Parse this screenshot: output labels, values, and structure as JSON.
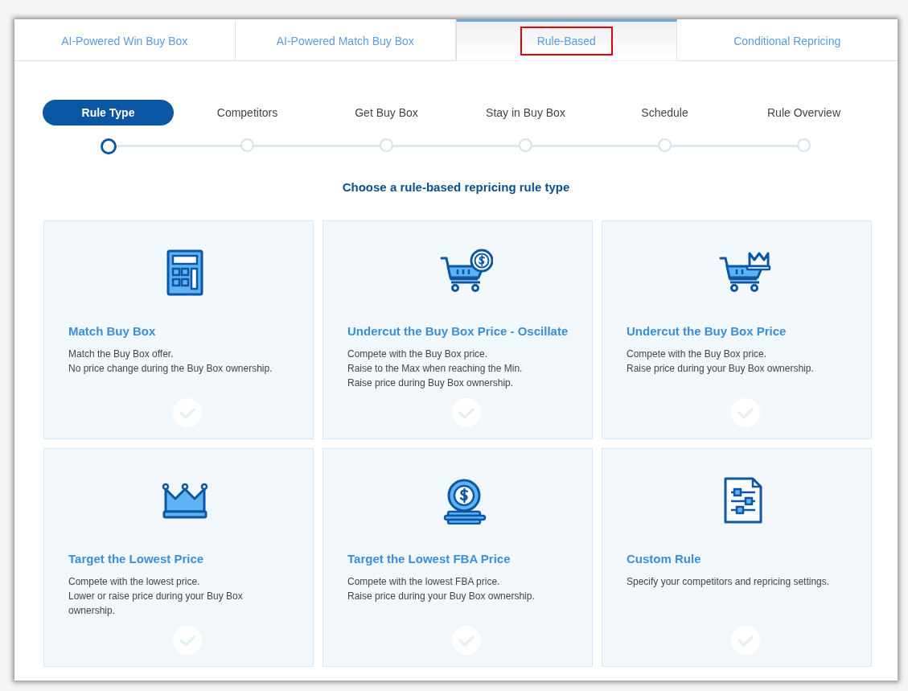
{
  "tabs": [
    {
      "label": "AI-Powered Win Buy Box",
      "selected": false,
      "highlighted": false
    },
    {
      "label": "AI-Powered Match Buy Box",
      "selected": false,
      "highlighted": false
    },
    {
      "label": "Rule-Based",
      "selected": true,
      "highlighted": true
    },
    {
      "label": "Conditional Repricing",
      "selected": false,
      "highlighted": false
    }
  ],
  "steps": [
    {
      "label": "Rule Type",
      "selected": true
    },
    {
      "label": "Competitors",
      "selected": false
    },
    {
      "label": "Get Buy Box",
      "selected": false
    },
    {
      "label": "Stay in Buy Box",
      "selected": false
    },
    {
      "label": "Schedule",
      "selected": false
    },
    {
      "label": "Rule Overview",
      "selected": false
    }
  ],
  "heading": "Choose a rule-based repricing rule type",
  "cards": [
    {
      "kind": "calculator",
      "title": "Match Buy Box",
      "lines": [
        "Match the Buy Box offer.",
        "No price change during the Buy Box ownership."
      ],
      "selected": false
    },
    {
      "kind": "cart-dollar",
      "title": "Undercut the Buy Box Price - Oscillate",
      "lines": [
        "Compete with the Buy Box price.",
        "Raise to the Max when reaching the Min.",
        "Raise price during Buy Box ownership."
      ],
      "selected": false
    },
    {
      "kind": "cart-crown",
      "title": "Undercut the Buy Box Price",
      "lines": [
        "Compete with the Buy Box price.",
        "Raise price during your Buy Box ownership."
      ],
      "selected": false
    },
    {
      "kind": "crown",
      "title": "Target the Lowest Price",
      "lines": [
        "Compete with the lowest price.",
        "Lower or raise price during your Buy Box ownership."
      ],
      "selected": false
    },
    {
      "kind": "coin-stack",
      "title": "Target the Lowest FBA Price",
      "lines": [
        "Compete with the lowest FBA price.",
        "Raise price during your Buy Box ownership."
      ],
      "selected": false
    },
    {
      "kind": "document-sliders",
      "title": "Custom Rule",
      "lines": [
        "Specify your competitors and repricing settings."
      ],
      "selected": false
    }
  ]
}
